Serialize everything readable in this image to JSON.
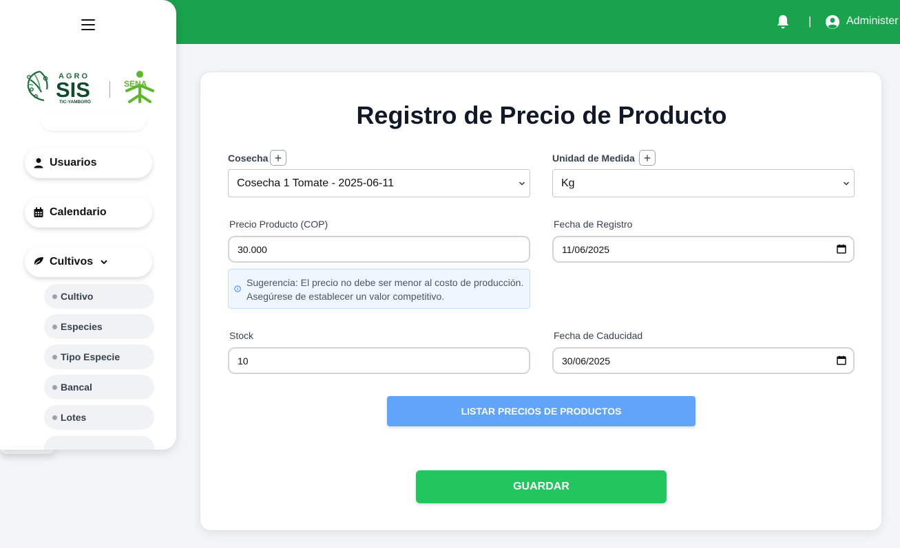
{
  "topbar": {
    "separator": "|",
    "user_name": "Administer"
  },
  "logo": {
    "agro_text": "AGRO",
    "sis_text": "SIS",
    "tic_text": "TIC-YAMBORÓ",
    "sena_text": "SENA"
  },
  "sidebar": {
    "items": [
      {
        "label": "Usuarios",
        "icon": "user-icon"
      },
      {
        "label": "Calendario",
        "icon": "calendar-icon"
      },
      {
        "label": "Cultivos",
        "icon": "leaf-icon"
      }
    ],
    "sub_items": [
      "Cultivo",
      "Especies",
      "Tipo Especie",
      "Bancal",
      "Lotes"
    ]
  },
  "form": {
    "title": "Registro de Precio de Producto",
    "cosecha_label": "Cosecha",
    "cosecha_value": "Cosecha 1 Tomate - 2025-06-11",
    "unidad_label": "Unidad de Medida",
    "unidad_value": "Kg",
    "precio_label": "Precio Producto (COP)",
    "precio_value": "30.000",
    "fecha_registro_label": "Fecha de Registro",
    "fecha_registro_value": "11/06/2025",
    "hint_line1": "Sugerencia: El precio no debe ser menor al costo de producción.",
    "hint_line2": "Asegúrese de establecer un valor competitivo.",
    "stock_label": "Stock",
    "stock_value": "10",
    "fecha_caducidad_label": "Fecha de Caducidad",
    "fecha_caducidad_value": "30/06/2025",
    "list_button": "LISTAR PRECIOS DE PRODUCTOS",
    "save_button": "GUARDAR",
    "plus_symbol": "+"
  },
  "colors": {
    "topbar": "#19a34c",
    "list_button": "#60a5fa",
    "save_button": "#22c55e",
    "logo_green": "#1f6b3a",
    "sena_green": "#5bb829"
  }
}
